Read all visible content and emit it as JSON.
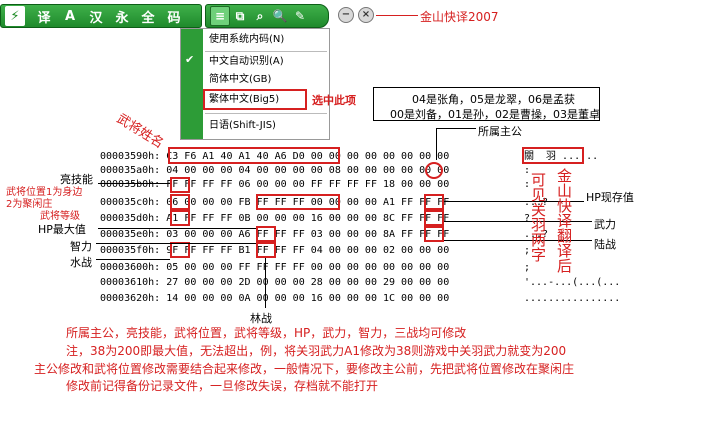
{
  "toolbar": {
    "buttons": [
      "⚡",
      "译",
      "A",
      "汉",
      "永",
      "全",
      "码"
    ],
    "icons2": [
      "≡",
      "⧉",
      "⌕",
      "🔍",
      "✎"
    ],
    "minimize": "−",
    "close": "×"
  },
  "app_label": "金山快译2007",
  "menu": {
    "items": [
      "使用系统内码(N)",
      "中文自动识别(A)",
      "简体中文(GB)",
      "繁体中文(Big5)",
      "日语(Shift-JIS)"
    ],
    "checked": "✔",
    "select_note": "选中此项"
  },
  "index_box": {
    "line1": "04是张角，05是龙翠，06是孟获",
    "line2": "00是刘备，01是孙，02是曹操，03是董卓"
  },
  "labels": {
    "general_name": "武将姓名",
    "lord": "所属主公",
    "skill": "亮技能",
    "position": "武将位置1为身边",
    "position2": "2为聚闲庄",
    "level": "武将等级",
    "hp_max": "HP最大值",
    "intel": "智力",
    "water": "水战",
    "forest": "林战",
    "hp_now": "HP现存值",
    "force": "武力",
    "land": "陆战",
    "guan_note": "可见关羽两字",
    "jinshan_note": "金山快译翻译后"
  },
  "hex": [
    {
      "addr": "00003590h:",
      "bytes": "C3 F6 A1 40 A1 40 A6 D0 00 00 00 00 00 00 00 00",
      "ascii": "關  羽 ......"
    },
    {
      "addr": "000035a0h:",
      "bytes": "04 00 00 00 04 00 00 00 00 08 00 00 00 00 00 00",
      "ascii": ":"
    },
    {
      "addr": "000035b0h:",
      "bytes": "FF FF FF FF 06 00 00 00 FF FF FF FF 18 00 00 00",
      "ascii": ":"
    },
    {
      "addr": "000035c0h:",
      "bytes": "06 00 00 00 FB FF FF FF 00 00 00 00 A1 FF FF FF",
      "ascii": "...?"
    },
    {
      "addr": "000035d0h:",
      "bytes": "A1 FF FF FF 0B 00 00 00 16 00 00 00 8C FF FF FF",
      "ascii": "?"
    },
    {
      "addr": "000035e0h:",
      "bytes": "03 00 00 00 A6 FF FF FF 03 00 00 00 8A FF FF FF",
      "ascii": "...?"
    },
    {
      "addr": "000035f0h:",
      "bytes": "9F FF FF FF B1 FF FF FF 04 00 00 00 02 00 00 00",
      "ascii": ";"
    },
    {
      "addr": "00003600h:",
      "bytes": "05 00 00 00 FF FF FF FF 00 00 00 00 00 00 00 00",
      "ascii": ";"
    },
    {
      "addr": "00003610h:",
      "bytes": "27 00 00 00 2D 00 00 00 28 00 00 00 29 00 00 00",
      "ascii": "'...-...(...(..."
    },
    {
      "addr": "00003620h:",
      "bytes": "14 00 00 00 0A 00 00 00 16 00 00 00 1C 00 00 00",
      "ascii": "................"
    }
  ],
  "notes": [
    "所属主公，亮技能，武将位置，武将等级，HP，武力，智力，三战均可修改",
    "注，38为200即最大值，无法超出，例，将关羽武力A1修改为38则游戏中关羽武力就变为200",
    "主公修改和武将位置修改需要结合起来修改，一般情况下，要修改主公前，先把武将位置修改在聚闲庄",
    "修改前记得备份记录文件，一旦修改失误，存档就不能打开"
  ],
  "colors": {
    "toolbar_green": "#2d9c37",
    "annotation_red": "#d62020"
  }
}
